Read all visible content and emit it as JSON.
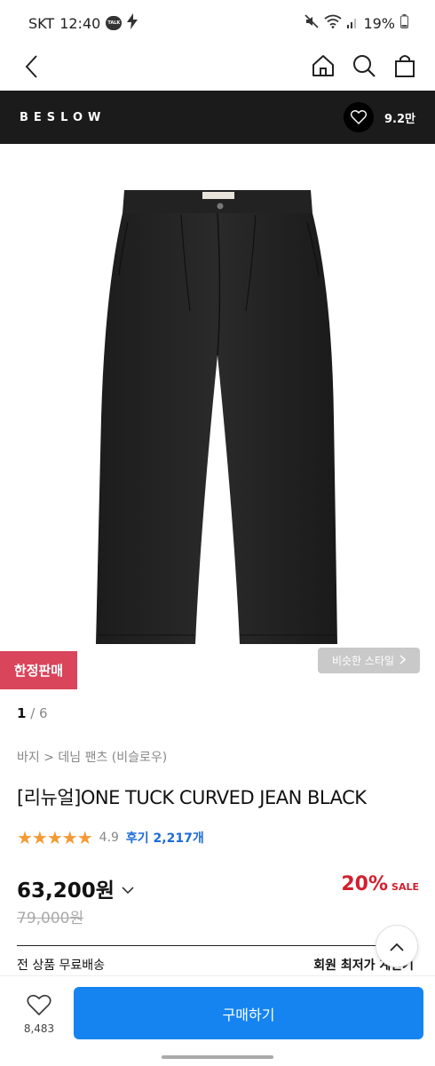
{
  "status_bar": {
    "carrier": "SKT",
    "time": "12:40",
    "battery": "19%"
  },
  "brand": {
    "name": "BESLOW",
    "like_count": "9.2만"
  },
  "gallery": {
    "limited_badge": "한정판매",
    "similar_style": "비슷한 스타일",
    "current_page": "1",
    "total_pages": "6"
  },
  "product": {
    "breadcrumb": "바지 > 데님 팬츠 (비슬로우)",
    "title": "[리뉴얼]ONE TUCK CURVED JEAN BLACK",
    "stars": "★★★★★",
    "rating": "4.9",
    "reviews": "후기 2,217개",
    "price": "63,200원",
    "discount_rate": "20%",
    "sale_label": "SALE",
    "original_price": "79,000원",
    "shipping": "전 상품 무료배송",
    "member_price": "회원 최저가 계산기"
  },
  "bottom_bar": {
    "wish_count": "8,483",
    "buy_label": "구매하기"
  },
  "colors": {
    "brand_bar": "#1b1b1b",
    "buy_button": "#1584f1",
    "limited_badge": "#d9455b",
    "discount": "#d1202f",
    "stars": "#f49a34"
  }
}
